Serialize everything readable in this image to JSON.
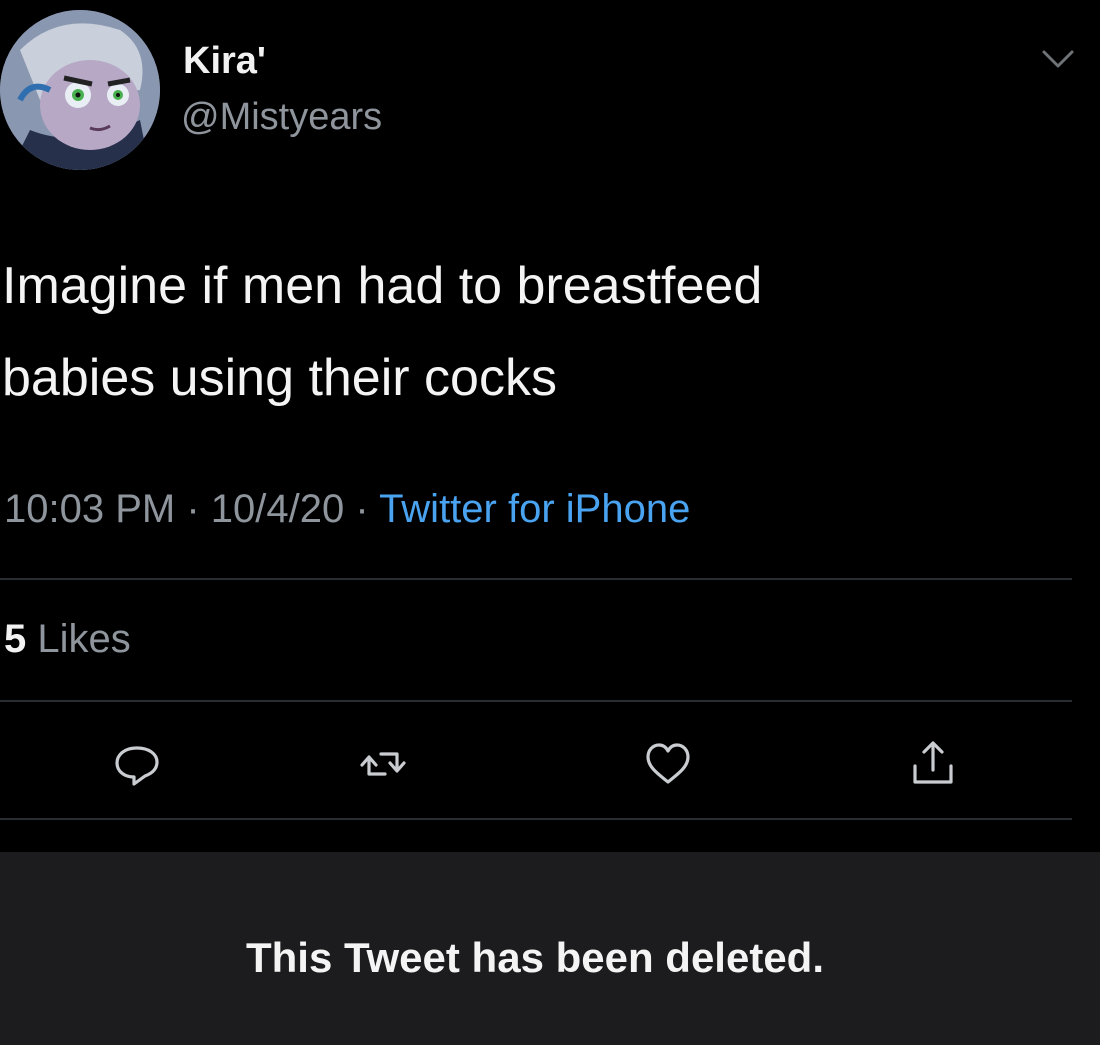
{
  "tweet": {
    "display_name": "Kira'",
    "handle": "@Mistyears",
    "text_line1": "Imagine if men had to breastfeed",
    "text_line2": "babies using their cocks",
    "time": "10:03 PM",
    "date": "10/4/20",
    "separator": " · ",
    "source": "Twitter for iPhone",
    "likes_count": "5",
    "likes_label": "Likes"
  },
  "actions": {
    "reply_icon": "reply-icon",
    "retweet_icon": "retweet-icon",
    "like_icon": "heart-icon",
    "share_icon": "share-icon"
  },
  "notice": {
    "text": "This Tweet has been deleted."
  },
  "colors": {
    "background": "#000000",
    "text": "#f4f4f4",
    "muted": "#8f959c",
    "link": "#4aa3f0",
    "notice_bg": "#1c1c1e"
  }
}
